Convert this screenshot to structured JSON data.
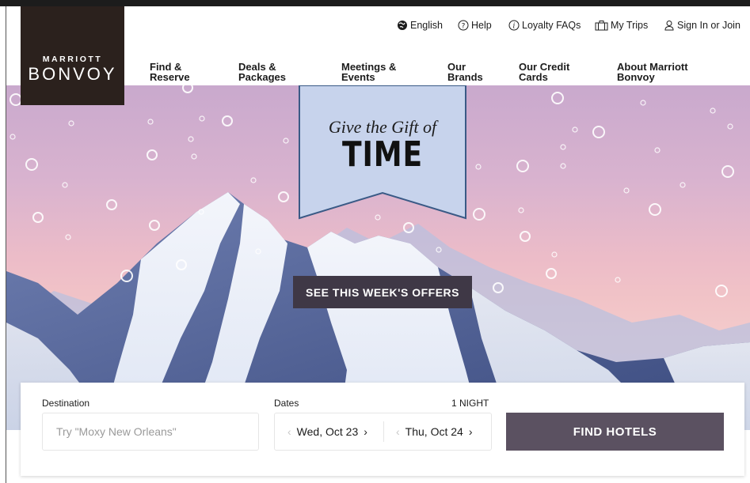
{
  "brand": {
    "line1": "MARRIOTT",
    "line2": "BONVOY"
  },
  "utility_nav": [
    {
      "label": "English",
      "icon": "globe-icon"
    },
    {
      "label": "Help",
      "icon": "question-circle-icon"
    },
    {
      "label": "Loyalty FAQs",
      "icon": "info-circle-icon"
    },
    {
      "label": "My Trips",
      "icon": "suitcase-icon"
    },
    {
      "label": "Sign In or Join",
      "icon": "user-icon"
    }
  ],
  "main_nav": [
    {
      "line1": "Find &",
      "line2": "Reserve"
    },
    {
      "line1": "Deals &",
      "line2": "Packages"
    },
    {
      "line1": "Meetings &",
      "line2": "Events"
    },
    {
      "line1": "Our",
      "line2": "Brands"
    },
    {
      "line1": "Our Credit",
      "line2": "Cards"
    },
    {
      "line1": "About Marriott",
      "line2": "Bonvoy"
    }
  ],
  "hero": {
    "banner_line1": "Give the Gift of",
    "banner_line2": "TIME",
    "cta_label": "SEE THIS WEEK'S OFFERS"
  },
  "search": {
    "destination_label": "Destination",
    "destination_placeholder": "Try \"Moxy New Orleans\"",
    "dates_label": "Dates",
    "nights": "1 NIGHT",
    "check_in": "Wed, Oct 23",
    "check_out": "Thu, Oct 24",
    "submit_label": "FIND HOTELS"
  },
  "colors": {
    "logo_bg": "#2b211d",
    "cta_bg": "#3f3846",
    "find_button_bg": "#5b5161",
    "banner_fill": "#c7d3ec",
    "banner_stroke": "#3a5a86"
  }
}
